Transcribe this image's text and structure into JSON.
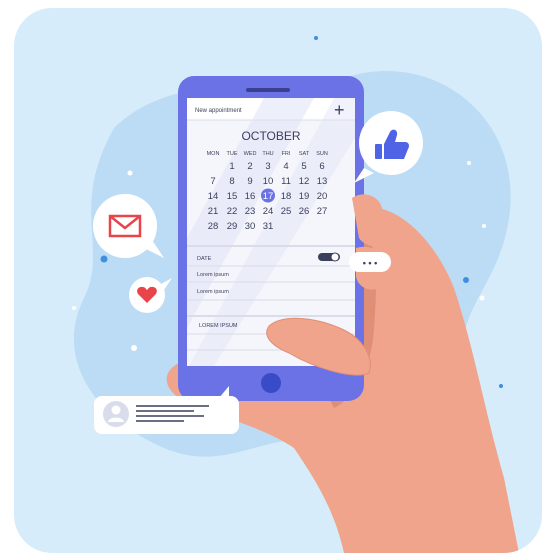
{
  "phone": {
    "header_title": "New appointment",
    "plus_glyph": "+",
    "month": "OCTOBER",
    "weekdays": [
      "MON",
      "TUE",
      "WED",
      "THU",
      "FRI",
      "SAT",
      "SUN"
    ],
    "weeks": [
      [
        "",
        "1",
        "2",
        "3",
        "4",
        "5",
        "6"
      ],
      [
        "7",
        "8",
        "9",
        "10",
        "11",
        "12",
        "13"
      ],
      [
        "14",
        "15",
        "16",
        "17",
        "18",
        "19",
        "20"
      ],
      [
        "21",
        "22",
        "23",
        "24",
        "25",
        "26",
        "27"
      ],
      [
        "28",
        "29",
        "30",
        "31",
        "",
        "",
        ""
      ]
    ],
    "selected_day": "17",
    "date_label": "DATE",
    "field1": "Lorem ipsum",
    "field2": "Lorem ipsum",
    "section_label": "LOREM IPSUM"
  },
  "bubbles": {
    "typing_dots": "• • •",
    "icons": [
      "thumbs-up-icon",
      "mail-icon",
      "heart-icon",
      "avatar-icon"
    ]
  },
  "colors": {
    "background": "#d6ecfa",
    "blob": "#bcdcf5",
    "phone_frame": "#6a72e6",
    "selected_day": "#6a72e6",
    "thumb": "#4f63e6",
    "mail": "#e8444a",
    "heart": "#e8444a",
    "skin": "#f0a48b"
  }
}
